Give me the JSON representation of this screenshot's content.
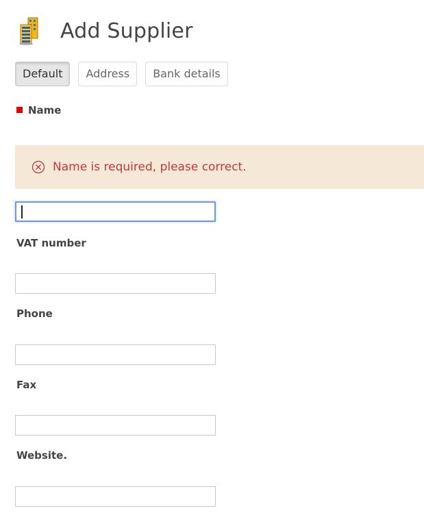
{
  "header": {
    "title": "Add Supplier",
    "icon": "supplier-buildings-icon"
  },
  "tabs": [
    {
      "label": "Default",
      "active": true
    },
    {
      "label": "Address",
      "active": false
    },
    {
      "label": "Bank details",
      "active": false
    }
  ],
  "alert": {
    "message": "Name is required, please correct.",
    "icon": "error-circle-x-icon",
    "text_color": "#c0393b",
    "background": "#f5e8d6"
  },
  "form": {
    "name": {
      "label": "Name",
      "required": true,
      "value": ""
    },
    "vat_number": {
      "label": "VAT number",
      "value": ""
    },
    "phone": {
      "label": "Phone",
      "value": ""
    },
    "fax": {
      "label": "Fax",
      "value": ""
    },
    "website": {
      "label": "Website.",
      "value": ""
    }
  },
  "colors": {
    "required_marker": "#e00000",
    "focus_border": "#6f9ad6"
  }
}
